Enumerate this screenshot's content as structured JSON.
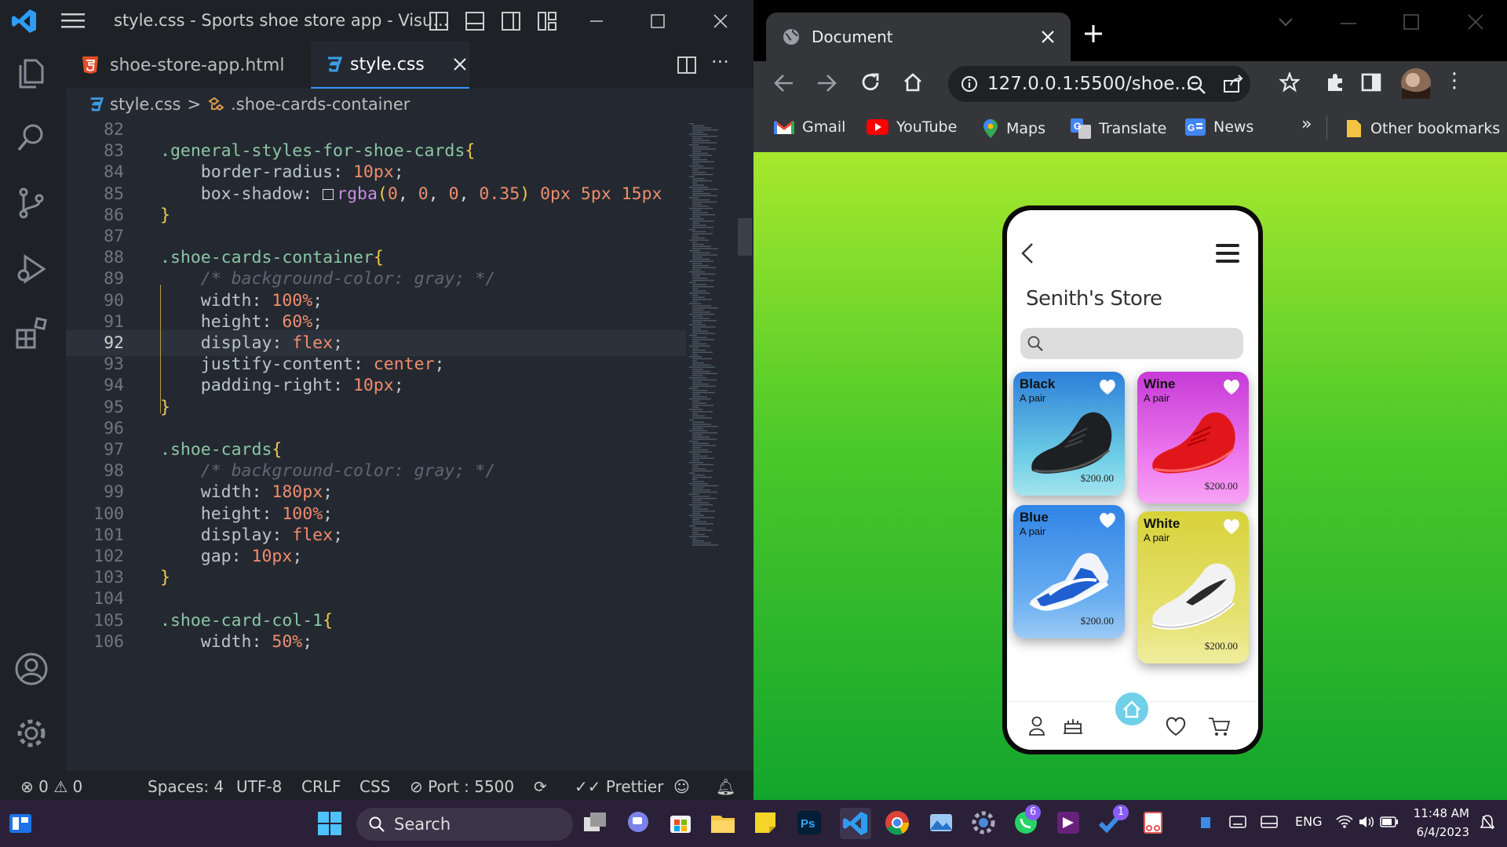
{
  "vscode": {
    "title": "style.css - Sports shoe store app - Visu...",
    "tabs": [
      {
        "label": "shoe-store-app.html"
      },
      {
        "label": "style.css"
      }
    ],
    "breadcrumb": {
      "file": "style.css",
      "separator": ">",
      "symbol": ".shoe-cards-container"
    },
    "code_lines": [
      {
        "n": "82",
        "t": ""
      },
      {
        "n": "83",
        "t": ".general-styles-for-shoe-cards{"
      },
      {
        "n": "84",
        "t": "    border-radius: 10px;"
      },
      {
        "n": "85",
        "t": "    box-shadow: rgba(0, 0, 0, 0.35) 0px 5px 15px"
      },
      {
        "n": "86",
        "t": "}"
      },
      {
        "n": "87",
        "t": ""
      },
      {
        "n": "88",
        "t": ".shoe-cards-container{"
      },
      {
        "n": "89",
        "t": "    /* background-color: gray; */"
      },
      {
        "n": "90",
        "t": "    width: 100%;"
      },
      {
        "n": "91",
        "t": "    height: 60%;"
      },
      {
        "n": "92",
        "t": "    display: flex;"
      },
      {
        "n": "93",
        "t": "    justify-content: center;"
      },
      {
        "n": "94",
        "t": "    padding-right: 10px;"
      },
      {
        "n": "95",
        "t": "}"
      },
      {
        "n": "96",
        "t": ""
      },
      {
        "n": "97",
        "t": ".shoe-cards{"
      },
      {
        "n": "98",
        "t": "    /* background-color: gray; */"
      },
      {
        "n": "99",
        "t": "    width: 180px;"
      },
      {
        "n": "100",
        "t": "    height: 100%;"
      },
      {
        "n": "101",
        "t": "    display: flex;"
      },
      {
        "n": "102",
        "t": "    gap: 10px;"
      },
      {
        "n": "103",
        "t": "}"
      },
      {
        "n": "104",
        "t": ""
      },
      {
        "n": "105",
        "t": ".shoe-card-col-1{"
      },
      {
        "n": "106",
        "t": "    width: 50%;"
      }
    ],
    "status": {
      "errors": "0",
      "warnings": "0",
      "spaces": "Spaces: 4",
      "encoding": "UTF-8",
      "eol": "CRLF",
      "language": "CSS",
      "port": "Port : 5500",
      "prettier": "Prettier"
    }
  },
  "chrome": {
    "tab_title": "Document",
    "url": "127.0.0.1:5500/shoe...",
    "bookmarks": [
      "Gmail",
      "YouTube",
      "Maps",
      "Translate",
      "News"
    ],
    "more": "»",
    "other_bookmarks": "Other bookmarks"
  },
  "store": {
    "title": "Senith's Store",
    "cards": [
      {
        "name": "Black",
        "sub": "A pair",
        "price": "$200.00",
        "color": "#1d1f22"
      },
      {
        "name": "Wine",
        "sub": "A pair",
        "price": "$200.00",
        "color": "#e0161b"
      },
      {
        "name": "Blue",
        "sub": "A pair",
        "price": "$200.00",
        "color": "#1f5fd0"
      },
      {
        "name": "White",
        "sub": "A pair",
        "price": "$200.00",
        "color": "#f2f2f2"
      }
    ]
  },
  "taskbar": {
    "search": "Search",
    "whatsapp_badge": "6",
    "todo_badge": "1",
    "lang": "ENG",
    "time": "11:48 AM",
    "date": "6/4/2023"
  },
  "colors": {
    "vscode_bg": "#242931",
    "accent": "#3794ff",
    "page_gradient_top": "#a7e82c",
    "page_gradient_bottom": "#12a52c",
    "taskbar": "#2a2138"
  }
}
